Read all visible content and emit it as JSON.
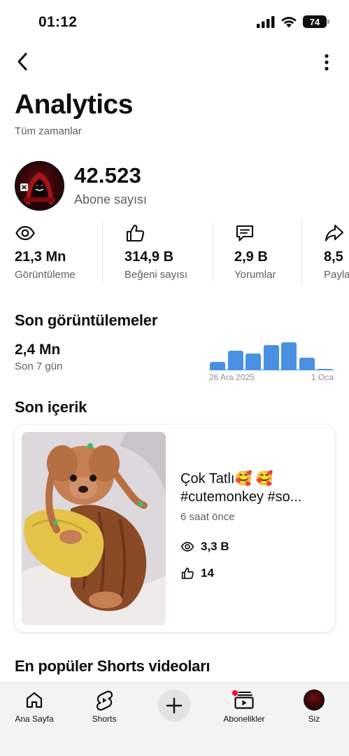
{
  "status_bar": {
    "time": "01:12",
    "battery": "74"
  },
  "header": {
    "title": "Analytics",
    "subtitle": "Tüm zamanlar"
  },
  "channel": {
    "subscriber_count": "42.523",
    "subscriber_label": "Abone sayısı",
    "avatar_text": "MI-TKA EDITZ ..."
  },
  "stats": [
    {
      "icon": "eye-icon",
      "value": "21,3 Mn",
      "label": "Görüntüleme"
    },
    {
      "icon": "thumbs-up-icon",
      "value": "314,9 B",
      "label": "Beğeni sayısı"
    },
    {
      "icon": "comment-icon",
      "value": "2,9 B",
      "label": "Yorumlar"
    },
    {
      "icon": "share-icon",
      "value": "8,5",
      "label": "Payla"
    }
  ],
  "recent_views": {
    "title": "Son görüntülemeler",
    "value": "2,4 Mn",
    "period": "Son 7 gün",
    "chart_start_label": "26 Ara 2025",
    "chart_end_label": "1 Oca",
    "bar_levels": [
      0.24,
      0.58,
      0.5,
      0.74,
      0.84,
      0.38,
      0.04
    ]
  },
  "recent_content": {
    "title": "Son içerik",
    "video_title_line1": "Çok Tatlı🥰 🥰",
    "video_title_line2": "#cutemonkey #so...",
    "time_ago": "6 saat önce",
    "views": "3,3 B",
    "likes": "14"
  },
  "popular": {
    "title": "En popüler Shorts videoları"
  },
  "tabs": [
    {
      "label": "Ana Sayfa",
      "icon": "home-icon"
    },
    {
      "label": "Shorts",
      "icon": "shorts-icon"
    },
    {
      "label": "",
      "icon": "plus-icon"
    },
    {
      "label": "Abonelikler",
      "icon": "subscriptions-icon"
    },
    {
      "label": "Siz",
      "icon": "profile-avatar"
    }
  ],
  "colors": {
    "accent_blue": "#4a90e2",
    "notification_red": "#ff0033",
    "text_secondary": "#606060"
  }
}
